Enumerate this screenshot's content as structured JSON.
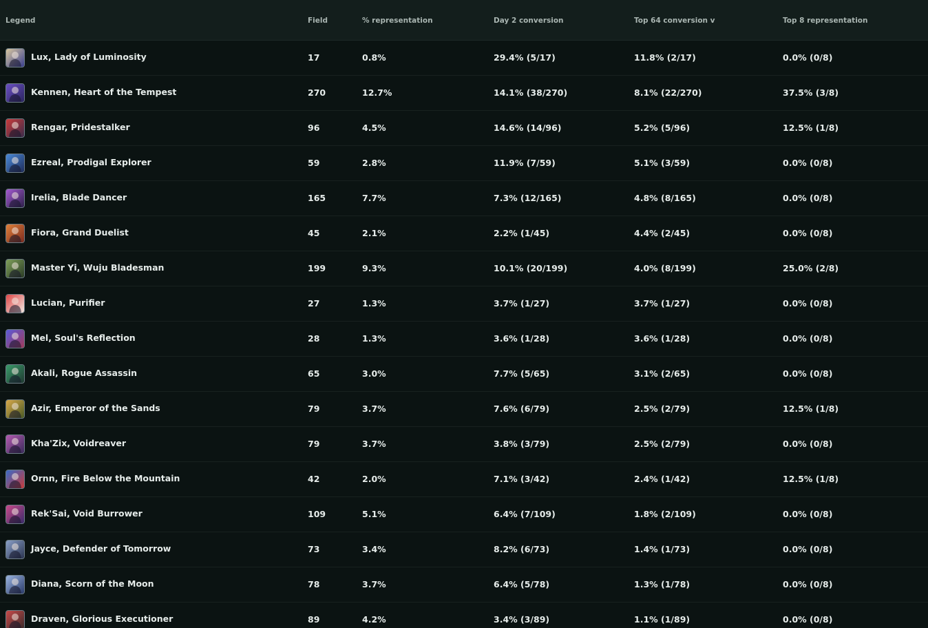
{
  "columns": {
    "legend": "Legend",
    "field": "Field",
    "representation": "% representation",
    "day2": "Day 2 conversion",
    "top64": "Top 64 conversion v",
    "top8": "Top 8 representation"
  },
  "rows": [
    {
      "legend": "Lux, Lady of Luminosity",
      "field": "17",
      "representation": "0.8%",
      "day2": "29.4% (5/17)",
      "top64": "11.8% (2/17)",
      "top8": "0.0% (0/8)",
      "icon": "lux-avatar-icon",
      "color_a": "#d8c7a0",
      "color_b": "#3a3f8f"
    },
    {
      "legend": "Kennen, Heart of the Tempest",
      "field": "270",
      "representation": "12.7%",
      "day2": "14.1% (38/270)",
      "top64": "8.1% (22/270)",
      "top8": "37.5% (3/8)",
      "icon": "kennen-avatar-icon",
      "color_a": "#6a4fc2",
      "color_b": "#2a2460"
    },
    {
      "legend": "Rengar, Pridestalker",
      "field": "96",
      "representation": "4.5%",
      "day2": "14.6% (14/96)",
      "top64": "5.2% (5/96)",
      "top8": "12.5% (1/8)",
      "icon": "rengar-avatar-icon",
      "color_a": "#c83b3b",
      "color_b": "#3b2b4a"
    },
    {
      "legend": "Ezreal, Prodigal Explorer",
      "field": "59",
      "representation": "2.8%",
      "day2": "11.9% (7/59)",
      "top64": "5.1% (3/59)",
      "top8": "0.0% (0/8)",
      "icon": "ezreal-avatar-icon",
      "color_a": "#4a8ad8",
      "color_b": "#1e2c5a"
    },
    {
      "legend": "Irelia, Blade Dancer",
      "field": "165",
      "representation": "7.7%",
      "day2": "7.3% (12/165)",
      "top64": "4.8% (8/165)",
      "top8": "0.0% (0/8)",
      "icon": "irelia-avatar-icon",
      "color_a": "#a45ad0",
      "color_b": "#2d1f4a"
    },
    {
      "legend": "Fiora, Grand Duelist",
      "field": "45",
      "representation": "2.1%",
      "day2": "2.2% (1/45)",
      "top64": "4.4% (2/45)",
      "top8": "0.0% (0/8)",
      "icon": "fiora-avatar-icon",
      "color_a": "#e0803a",
      "color_b": "#7a2a1e"
    },
    {
      "legend": "Master Yi, Wuju Bladesman",
      "field": "199",
      "representation": "9.3%",
      "day2": "10.1% (20/199)",
      "top64": "4.0% (8/199)",
      "top8": "25.0% (2/8)",
      "icon": "master-yi-avatar-icon",
      "color_a": "#7fa05a",
      "color_b": "#2a3a24"
    },
    {
      "legend": "Lucian, Purifier",
      "field": "27",
      "representation": "1.3%",
      "day2": "3.7% (1/27)",
      "top64": "3.7% (1/27)",
      "top8": "0.0% (0/8)",
      "icon": "lucian-avatar-icon",
      "color_a": "#e04848",
      "color_b": "#f0e6e0"
    },
    {
      "legend": "Mel, Soul's Reflection",
      "field": "28",
      "representation": "1.3%",
      "day2": "3.6% (1/28)",
      "top64": "3.6% (1/28)",
      "top8": "0.0% (0/8)",
      "icon": "mel-avatar-icon",
      "color_a": "#5a5ad8",
      "color_b": "#a03a5a"
    },
    {
      "legend": "Akali, Rogue Assassin",
      "field": "65",
      "representation": "3.0%",
      "day2": "7.7% (5/65)",
      "top64": "3.1% (2/65)",
      "top8": "0.0% (0/8)",
      "icon": "akali-avatar-icon",
      "color_a": "#3a9a6a",
      "color_b": "#1f3a30"
    },
    {
      "legend": "Azir, Emperor of the Sands",
      "field": "79",
      "representation": "3.7%",
      "day2": "7.6% (6/79)",
      "top64": "2.5% (2/79)",
      "top8": "12.5% (1/8)",
      "icon": "azir-avatar-icon",
      "color_a": "#d8a84a",
      "color_b": "#4a5a24"
    },
    {
      "legend": "Kha'Zix, Voidreaver",
      "field": "79",
      "representation": "3.7%",
      "day2": "3.8% (3/79)",
      "top64": "2.5% (2/79)",
      "top8": "0.0% (0/8)",
      "icon": "khazix-avatar-icon",
      "color_a": "#b45ab0",
      "color_b": "#3a2a5a"
    },
    {
      "legend": "Ornn, Fire Below the Mountain",
      "field": "42",
      "representation": "2.0%",
      "day2": "7.1% (3/42)",
      "top64": "2.4% (1/42)",
      "top8": "12.5% (1/8)",
      "icon": "ornn-avatar-icon",
      "color_a": "#3a6ac8",
      "color_b": "#c83a3a"
    },
    {
      "legend": "Rek'Sai, Void Burrower",
      "field": "109",
      "representation": "5.1%",
      "day2": "6.4% (7/109)",
      "top64": "1.8% (2/109)",
      "top8": "0.0% (0/8)",
      "icon": "reksai-avatar-icon",
      "color_a": "#c84a8a",
      "color_b": "#3a2a6a"
    },
    {
      "legend": "Jayce, Defender of Tomorrow",
      "field": "73",
      "representation": "3.4%",
      "day2": "8.2% (6/73)",
      "top64": "1.4% (1/73)",
      "top8": "0.0% (0/8)",
      "icon": "jayce-avatar-icon",
      "color_a": "#8aa0c8",
      "color_b": "#2a3450"
    },
    {
      "legend": "Diana, Scorn of the Moon",
      "field": "78",
      "representation": "3.7%",
      "day2": "6.4% (5/78)",
      "top64": "1.3% (1/78)",
      "top8": "0.0% (0/8)",
      "icon": "diana-avatar-icon",
      "color_a": "#9ab4e0",
      "color_b": "#2a3a6a"
    },
    {
      "legend": "Draven, Glorious Executioner",
      "field": "89",
      "representation": "4.2%",
      "day2": "3.4% (3/89)",
      "top64": "1.1% (1/89)",
      "top8": "0.0% (0/8)",
      "icon": "draven-avatar-icon",
      "color_a": "#c84a4a",
      "color_b": "#3a2a2a"
    }
  ]
}
